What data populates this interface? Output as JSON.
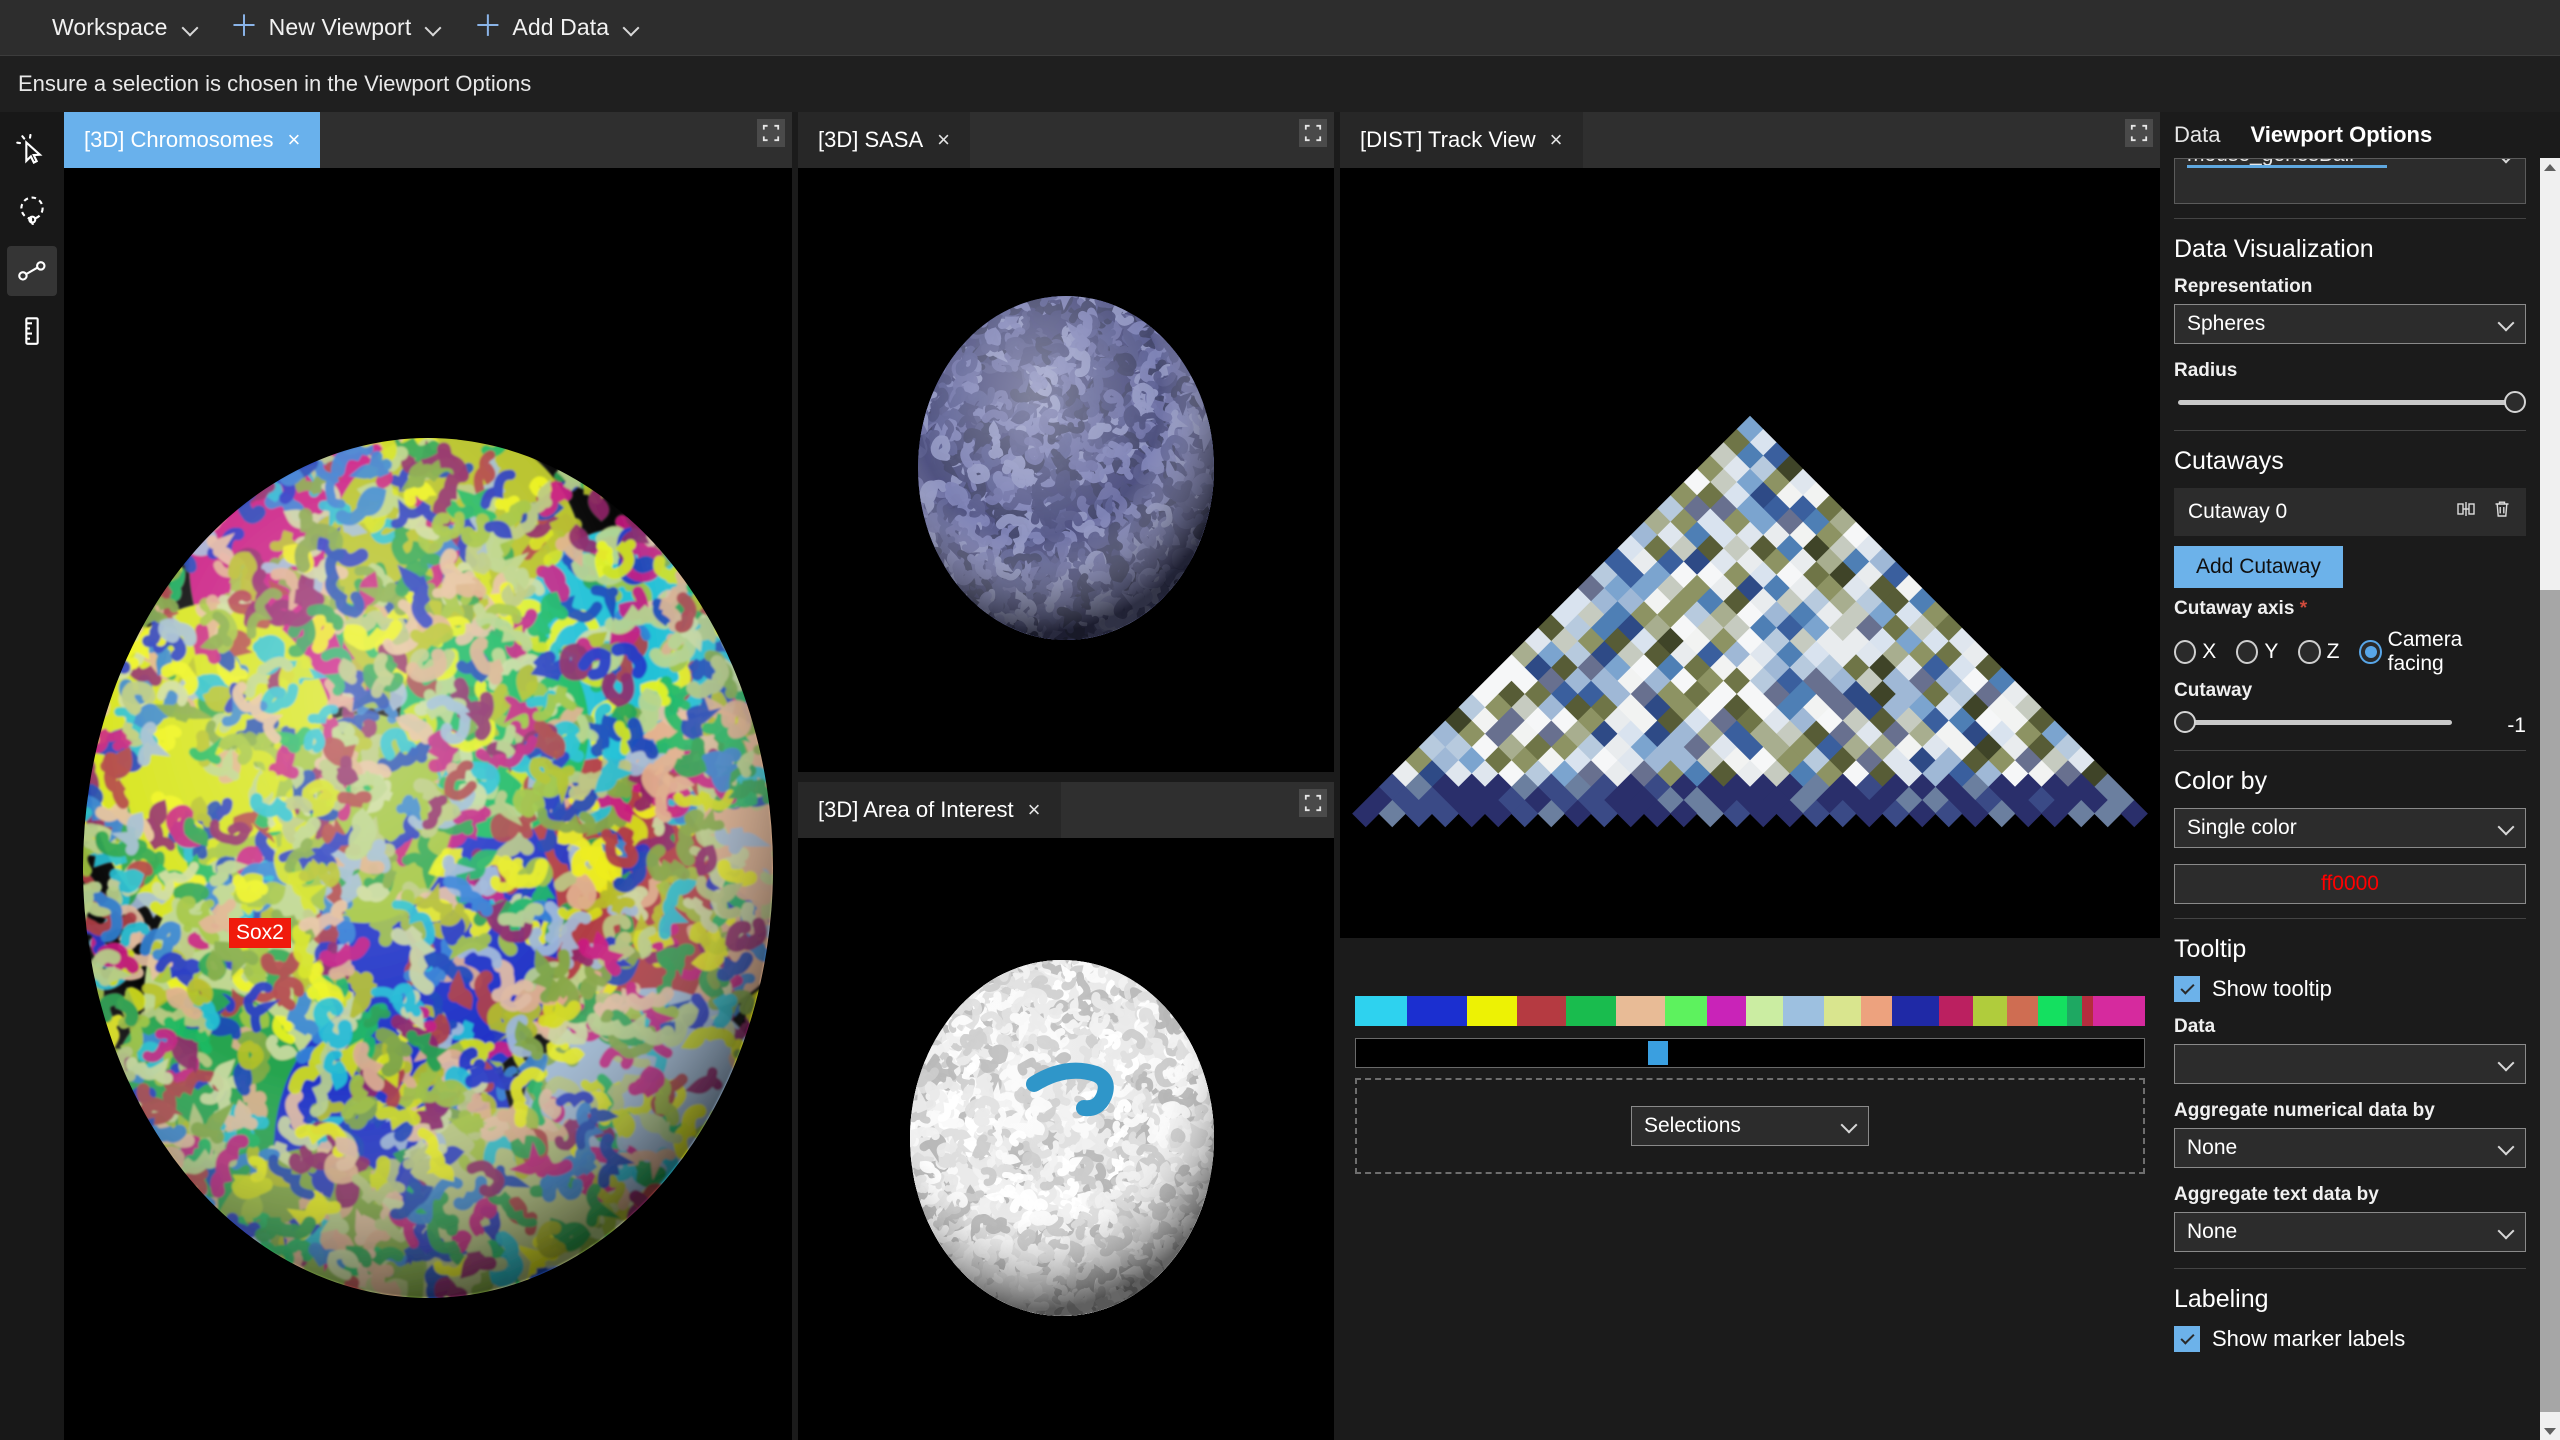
{
  "menubar": {
    "items": [
      {
        "label": "Workspace",
        "has_plus": false,
        "has_chevron": true
      },
      {
        "label": "New Viewport",
        "has_plus": true,
        "has_chevron": true
      },
      {
        "label": "Add Data",
        "has_plus": true,
        "has_chevron": true
      }
    ]
  },
  "status": {
    "message": "Ensure a selection is chosen in the Viewport Options"
  },
  "rail": {
    "items": [
      {
        "name": "click-select-icon",
        "active": false
      },
      {
        "name": "lasso-select-icon",
        "active": false
      },
      {
        "name": "path-select-icon",
        "active": true
      },
      {
        "name": "ruler-measure-icon",
        "active": false
      }
    ]
  },
  "viewports": [
    {
      "id": "chromosomes",
      "tab_label": "[3D] Chromosomes",
      "selected": true,
      "close_label": "×",
      "expand_icon": "expand-icon"
    },
    {
      "id": "sasa",
      "tab_label": "[3D] SASA",
      "selected": false,
      "close_label": "×",
      "expand_icon": "expand-icon"
    },
    {
      "id": "aoi",
      "tab_label": "[3D] Area of Interest",
      "selected": false,
      "close_label": "×",
      "expand_icon": "expand-icon"
    },
    {
      "id": "track",
      "tab_label": "[DIST] Track View",
      "selected": false,
      "close_label": "×",
      "expand_icon": "expand-icon"
    }
  ],
  "chromosomes_view": {
    "marker_label": "Sox2",
    "marker_color": "#f01b0c"
  },
  "track_view": {
    "selections_dropdown": {
      "value": "Selections"
    },
    "chromosome_colors": [
      "#2ed2ef",
      "#1b2fd0",
      "#edf204",
      "#b53a41",
      "#19bc4e",
      "#e8bb96",
      "#5df25e",
      "#c923b8",
      "#cbeda2",
      "#9dc0e0",
      "#d9e58e",
      "#eda27e",
      "#1f29a6",
      "#bb2060",
      "#b0cc3c",
      "#cf6d52",
      "#14e060",
      "#1ea862",
      "#b52d3e",
      "#d62a9e"
    ],
    "chromosome_widths": [
      40,
      46,
      38,
      38,
      38,
      38,
      32,
      30,
      28,
      32,
      28,
      24,
      36,
      26,
      26,
      24,
      22,
      12,
      8,
      40
    ]
  },
  "chart_data": {
    "type": "heatmap",
    "title": "",
    "description": "Lower-triangular Hi-C style contact/distance matrix rendered as a 45-degree rotated grid triangle",
    "xlabel": "",
    "ylabel": "",
    "colormap": [
      "#1b2a5a",
      "#3a3f26",
      "#4f5630",
      "#6d7146",
      "#8e9a62",
      "#b4bcae",
      "#4a7fb5",
      "#7ba3cf",
      "#aec6e2",
      "#d7e2ef",
      "#f4f4f2",
      "#2a2f6b"
    ],
    "n_bins": 42,
    "legend": "none",
    "grid": false
  },
  "right_panel": {
    "tabs": [
      {
        "label": "Data",
        "active": false
      },
      {
        "label": "Viewport Options",
        "active": true
      }
    ],
    "scrolled_field_value": "mouse_genesBall",
    "data_visualization": {
      "title": "Data Visualization",
      "representation_label": "Representation",
      "representation_value": "Spheres",
      "radius_label": "Radius",
      "radius_pct": 98
    },
    "cutaways": {
      "title": "Cutaways",
      "items": [
        {
          "label": "Cutaway 0",
          "duplicate_icon": "duplicate-icon",
          "delete_icon": "trash-icon"
        }
      ],
      "add_button": "Add Cutaway",
      "axis_label": "Cutaway axis",
      "axis_required_marker": "*",
      "axis_options": [
        {
          "label": "X",
          "selected": false
        },
        {
          "label": "Y",
          "selected": false
        },
        {
          "label": "Z",
          "selected": false
        },
        {
          "label": "Camera facing",
          "selected": true
        }
      ],
      "cutaway_slider_label": "Cutaway",
      "cutaway_value": "-1",
      "cutaway_pct": 0
    },
    "color_by": {
      "title": "Color by",
      "mode_value": "Single color",
      "color_hex_text": "ff0000",
      "color_hex": "#ff0000"
    },
    "tooltip": {
      "title": "Tooltip",
      "show_tooltip_label": "Show tooltip",
      "show_tooltip_checked": true,
      "data_label": "Data",
      "data_value": "",
      "agg_num_label": "Aggregate numerical data by",
      "agg_num_value": "None",
      "agg_text_label": "Aggregate text data by",
      "agg_text_value": "None"
    },
    "labeling": {
      "title": "Labeling",
      "show_marker_labels_label": "Show marker labels",
      "show_marker_labels_checked": true
    }
  }
}
